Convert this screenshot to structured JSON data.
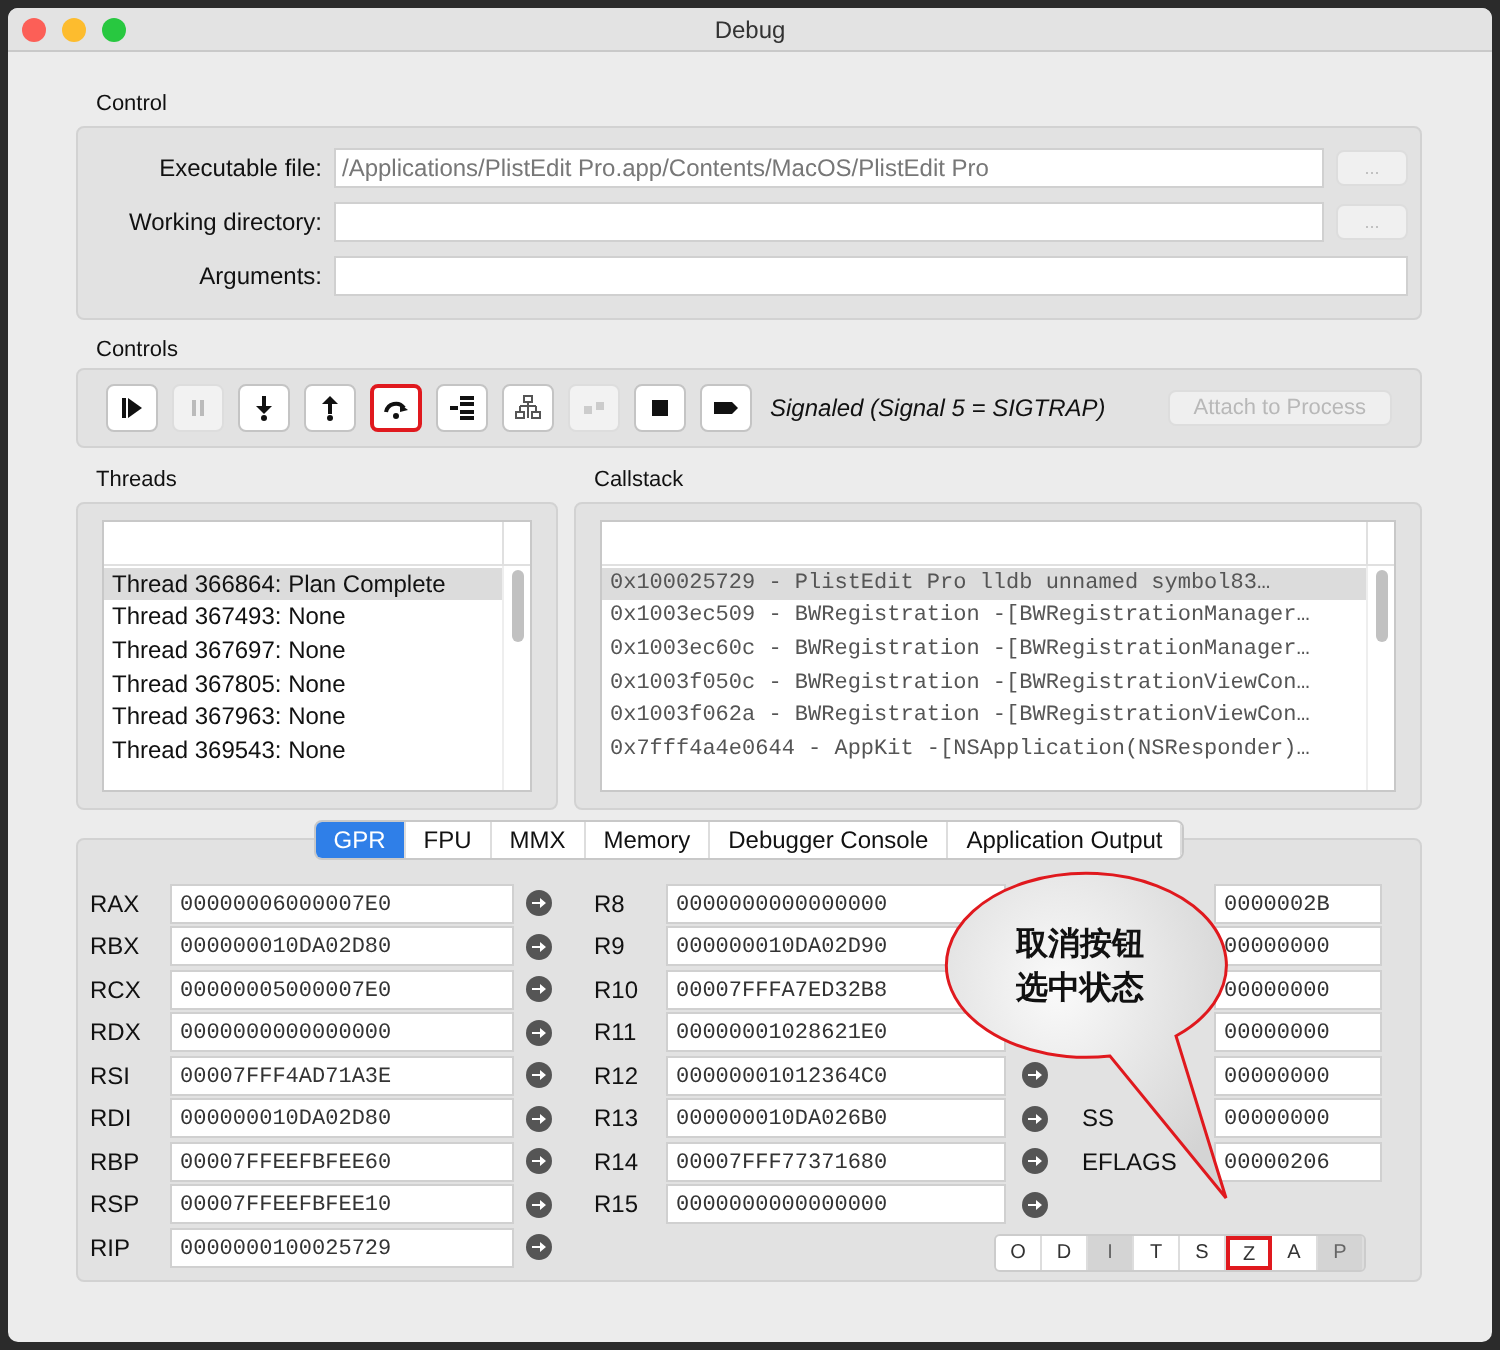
{
  "window": {
    "title": "Debug"
  },
  "control": {
    "title": "Control",
    "fields": [
      {
        "label": "Executable file:",
        "value": "/Applications/PlistEdit Pro.app/Contents/MacOS/PlistEdit Pro",
        "browse": {
          "label": "...",
          "disabled": true
        }
      },
      {
        "label": "Working directory:",
        "browse": {
          "label": "...",
          "disabled": true
        }
      },
      {
        "label": "Arguments:"
      }
    ]
  },
  "controls": {
    "title": "Controls",
    "buttons": [
      {
        "kind": "continue",
        "disabled": false,
        "highlighted": false
      },
      {
        "kind": "pause",
        "disabled": true,
        "highlighted": false
      },
      {
        "kind": "step-into",
        "disabled": false,
        "highlighted": false
      },
      {
        "kind": "step-out",
        "disabled": false,
        "highlighted": false
      },
      {
        "kind": "step-over",
        "disabled": false,
        "highlighted": true
      },
      {
        "kind": "step-instruction",
        "disabled": false,
        "highlighted": false
      },
      {
        "kind": "flowchart",
        "disabled": false,
        "highlighted": false
      },
      {
        "kind": "blocks",
        "disabled": true,
        "highlighted": false
      },
      {
        "kind": "stop",
        "disabled": false,
        "highlighted": false
      },
      {
        "kind": "detach",
        "disabled": false,
        "highlighted": false
      }
    ],
    "status": "Signaled (Signal 5 = SIGTRAP)",
    "attach_button": {
      "label": "Attach to Process",
      "disabled": true
    }
  },
  "threads": {
    "title": "Threads",
    "rows": [
      {
        "label": "Thread 366864: Plan Complete",
        "selected": true
      },
      {
        "label": "Thread 367493: None",
        "selected": false
      },
      {
        "label": "Thread 367697: None",
        "selected": false
      },
      {
        "label": "Thread 367805: None",
        "selected": false
      },
      {
        "label": "Thread 367963: None",
        "selected": false
      },
      {
        "label": "Thread 369543: None",
        "selected": false
      }
    ]
  },
  "callstack": {
    "title": "Callstack",
    "rows": [
      {
        "label": "0x100025729 - PlistEdit Pro    lldb unnamed symbol83…",
        "selected": true
      },
      {
        "label": "0x1003ec509 - BWRegistration -[BWRegistrationManager…",
        "selected": false
      },
      {
        "label": "0x1003ec60c - BWRegistration -[BWRegistrationManager…",
        "selected": false
      },
      {
        "label": "0x1003f050c - BWRegistration -[BWRegistrationViewCon…",
        "selected": false
      },
      {
        "label": "0x1003f062a - BWRegistration -[BWRegistrationViewCon…",
        "selected": false
      },
      {
        "label": "0x7fff4a4e0644 - AppKit -[NSApplication(NSResponder)…",
        "selected": false
      }
    ]
  },
  "tabs": [
    {
      "label": "GPR",
      "selected": true
    },
    {
      "label": "FPU",
      "selected": false
    },
    {
      "label": "MMX",
      "selected": false
    },
    {
      "label": "Memory",
      "selected": false
    },
    {
      "label": "Debugger Console",
      "selected": false
    },
    {
      "label": "Application Output",
      "selected": false
    }
  ],
  "registers": {
    "columns": [
      [
        {
          "name": "RAX",
          "value": "00000006000007E0"
        },
        {
          "name": "RBX",
          "value": "000000010DA02D80"
        },
        {
          "name": "RCX",
          "value": "00000005000007E0"
        },
        {
          "name": "RDX",
          "value": "0000000000000000"
        },
        {
          "name": "RSI",
          "value": "00007FFF4AD71A3E"
        },
        {
          "name": "RDI",
          "value": "000000010DA02D80"
        },
        {
          "name": "RBP",
          "value": "00007FFEEFBFEE60"
        },
        {
          "name": "RSP",
          "value": "00007FFEEFBFEE10"
        },
        {
          "name": "RIP",
          "value": "0000000100025729"
        }
      ],
      [
        {
          "name": "R8",
          "value": "0000000000000000"
        },
        {
          "name": "R9",
          "value": "000000010DA02D90"
        },
        {
          "name": "R10",
          "value": "00007FFFA7ED32B8"
        },
        {
          "name": "R11",
          "value": "00000001028621E0"
        },
        {
          "name": "R12",
          "value": "00000001012364C0"
        },
        {
          "name": "R13",
          "value": "000000010DA026B0"
        },
        {
          "name": "R14",
          "value": "00007FFF77371680"
        },
        {
          "name": "R15",
          "value": "0000000000000000"
        }
      ],
      [
        {
          "value": "0000002B"
        },
        {
          "value": "00000000"
        },
        {
          "value": "00000000"
        },
        {
          "value": "00000000"
        },
        {
          "value": "00000000"
        },
        {
          "name": "SS",
          "value": "00000000"
        },
        {
          "name": "EFLAGS",
          "value": "00000206"
        }
      ]
    ]
  },
  "flags": [
    {
      "label": "O",
      "set": false,
      "highlighted": false
    },
    {
      "label": "D",
      "set": false,
      "highlighted": false
    },
    {
      "label": "I",
      "set": true,
      "highlighted": false
    },
    {
      "label": "T",
      "set": false,
      "highlighted": false
    },
    {
      "label": "S",
      "set": false,
      "highlighted": false
    },
    {
      "label": "Z",
      "set": false,
      "highlighted": true
    },
    {
      "label": "A",
      "set": false,
      "highlighted": false
    },
    {
      "label": "P",
      "set": true,
      "highlighted": false
    }
  ],
  "callout": {
    "lines": [
      "取消按钮",
      "选中状态"
    ]
  }
}
